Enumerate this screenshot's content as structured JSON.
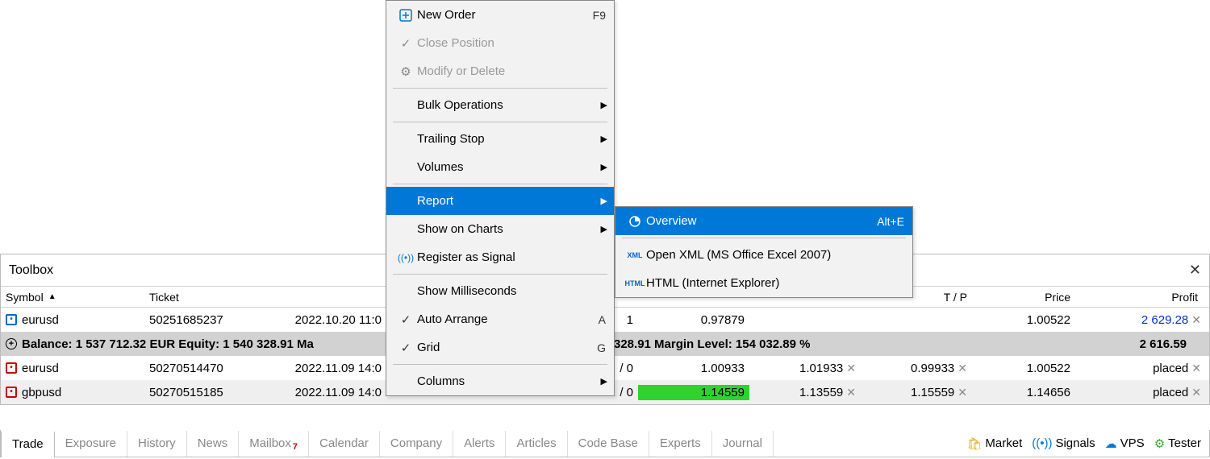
{
  "toolbox": {
    "title": "Toolbox"
  },
  "columns": {
    "symbol": "Symbol",
    "ticket": "Ticket",
    "time": "",
    "type": "",
    "sl": "",
    "tp": "T / P",
    "price2": "Price",
    "profit": "Profit"
  },
  "rows": [
    {
      "sym_class": "blue",
      "symbol": "eurusd",
      "ticket": "50251685237",
      "time": "2022.10.20 11:0",
      "vol": "1",
      "price": "0.97879",
      "sl": "",
      "tp": "",
      "price2": "1.00522",
      "profit": "2 629.28",
      "profit_class": "blue-text",
      "x": true
    },
    {
      "balance": true,
      "text_left": "Balance: 1 537 712.32 EUR  Equity: 1 540 328.91  Ma",
      "text_right": "328.91  Margin Level: 154 032.89 %",
      "profit": "2 616.59"
    },
    {
      "sym_class": "red",
      "symbol": "eurusd",
      "ticket": "50270514470",
      "time": "2022.11.09 14:0",
      "vol": "/ 0",
      "price": "1.00933",
      "sl": "1.01933",
      "tp": "0.99933",
      "price2": "1.00522",
      "profit": "placed",
      "x": true,
      "slx": true,
      "tpx": true
    },
    {
      "sym_class": "red",
      "symbol": "gbpusd",
      "ticket": "50270515185",
      "time": "2022.11.09 14:0",
      "vol": "/ 0",
      "price": "1.14559",
      "price_green": true,
      "sl": "1.13559",
      "tp": "1.15559",
      "price2": "1.14656",
      "profit": "placed",
      "alt": true,
      "x": true,
      "slx": true,
      "tpx": true
    }
  ],
  "tabs": [
    "Trade",
    "Exposure",
    "History",
    "News",
    "Mailbox",
    "Calendar",
    "Company",
    "Alerts",
    "Articles",
    "Code Base",
    "Experts",
    "Journal"
  ],
  "mailbox_badge": "7",
  "statusbar": {
    "market": "Market",
    "signals": "Signals",
    "vps": "VPS",
    "tester": "Tester"
  },
  "menu": {
    "new_order": "New Order",
    "new_order_sc": "F9",
    "close_pos": "Close Position",
    "modify": "Modify or Delete",
    "bulk": "Bulk Operations",
    "trailing": "Trailing Stop",
    "volumes": "Volumes",
    "report": "Report",
    "show_charts": "Show on Charts",
    "register": "Register as Signal",
    "show_ms": "Show Milliseconds",
    "auto_arrange": "Auto Arrange",
    "auto_arrange_sc": "A",
    "grid": "Grid",
    "grid_sc": "G",
    "columns": "Columns"
  },
  "submenu": {
    "overview": "Overview",
    "overview_sc": "Alt+E",
    "xml": "Open XML (MS Office Excel 2007)",
    "html": "HTML (Internet Explorer)"
  }
}
